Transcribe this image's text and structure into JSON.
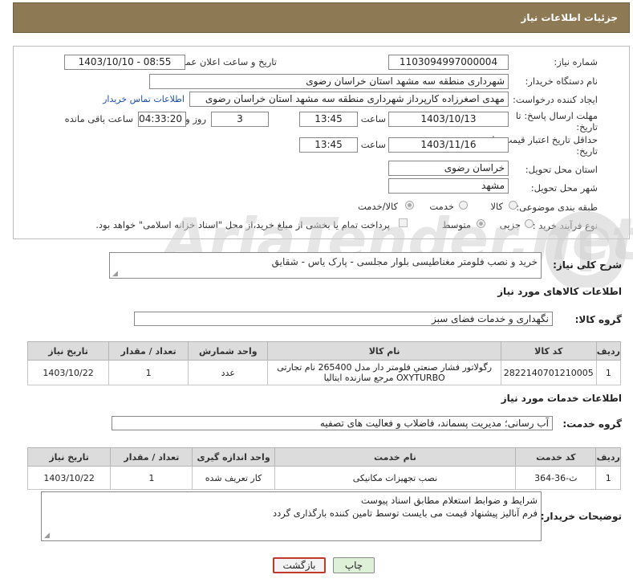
{
  "header": {
    "title": "جزئیات اطلاعات نیاز"
  },
  "form": {
    "need_number": {
      "label": "شماره نیاز:",
      "value": "1103094997000004"
    },
    "announce_datetime": {
      "label": "تاریخ و ساعت اعلان عمومی:",
      "value": "1403/10/10 - 08:55"
    },
    "buyer_org": {
      "label": "نام دستگاه خریدار:",
      "value": "شهرداری منطقه سه مشهد استان خراسان رضوی"
    },
    "requester": {
      "label": "ایجاد کننده درخواست:",
      "value": "مهدی اصغرزاده کارپرداز شهرداری منطقه سه مشهد استان خراسان رضوی"
    },
    "contact_link": "اطلاعات تماس خریدار",
    "reply_deadline": {
      "label_line1": "مهلت ارسال پاسخ: تا",
      "label_line2": "تاریخ:",
      "date": "1403/10/13",
      "time_label": "ساعت",
      "time": "13:45",
      "days": "3",
      "days_label": "روز و",
      "remaining": "04:33:20",
      "remaining_label": "ساعت باقی مانده"
    },
    "price_validity": {
      "label_line1": "حداقل تاریخ اعتبار قیمت: تا",
      "label_line2": "تاریخ:",
      "date": "1403/11/16",
      "time_label": "ساعت",
      "time": "13:45"
    },
    "delivery_province": {
      "label": "استان محل تحویل:",
      "value": "خراسان رضوی"
    },
    "delivery_city": {
      "label": "شهر محل تحویل:",
      "value": "مشهد"
    },
    "category": {
      "label": "طبقه بندی موضوعی:",
      "options": [
        "کالا",
        "خدمت",
        "کالا/خدمت"
      ],
      "selected": "کالا/خدمت"
    },
    "purchase_process": {
      "label": "نوع فرآیند خرید :",
      "options": [
        "جزیی",
        "متوسط"
      ],
      "selected": "متوسط",
      "payment_note": "پرداخت تمام یا بخشی از مبلغ خرید،از محل \"اسناد خزانه اسلامی\" خواهد بود."
    }
  },
  "description": {
    "label": "شرح کلی نیاز:",
    "value": "خرید و نصب فلومتر مغناطیسی بلوار مجلسی - پارک یاس - شقایق"
  },
  "goods": {
    "section_title": "اطلاعات کالاهای مورد نیاز",
    "group_label": "گروه کالا:",
    "group_value": "نگهداری و خدمات فضای سبز",
    "columns": [
      "ردیف",
      "کد کالا",
      "نام کالا",
      "واحد شمارش",
      "تعداد / مقدار",
      "تاریخ نیاز"
    ],
    "rows": [
      [
        "1",
        "2822140701210005",
        "رگولاتور فشار صنعتي فلومتر دار مدل 265400 نام تجارتی OXYTURBO مرجع سازنده ایتالیا",
        "عدد",
        "1",
        "1403/10/22"
      ]
    ]
  },
  "services": {
    "section_title": "اطلاعات خدمات مورد نیاز",
    "group_label": "گروه خدمت:",
    "group_value": "آب رسانی؛ مدیریت پسماند، فاضلاب و فعالیت های تصفیه",
    "columns": [
      "ردیف",
      "کد خدمت",
      "نام خدمت",
      "واحد اندازه گیری",
      "تعداد / مقدار",
      "تاریخ نیاز"
    ],
    "rows": [
      [
        "1",
        "ث-36-364",
        "نصب تجهیزات مکانیکی",
        "کار تعریف شده",
        "1",
        "1403/10/22"
      ]
    ]
  },
  "buyer_notes": {
    "label": "توضیحات خریدار:",
    "line1": "شرایط و ضوابط استعلام مطابق اسناد پیوست",
    "line2": "فرم آنالیز پیشنهاد قیمت می بایست توسط تامین کننده بارگذاری گردد"
  },
  "buttons": {
    "print": "چاپ",
    "back": "بازگشت"
  },
  "colors": {
    "header": "#8d7a55",
    "back_button_border": "#c0392b",
    "print_button": "#dff0d8"
  }
}
